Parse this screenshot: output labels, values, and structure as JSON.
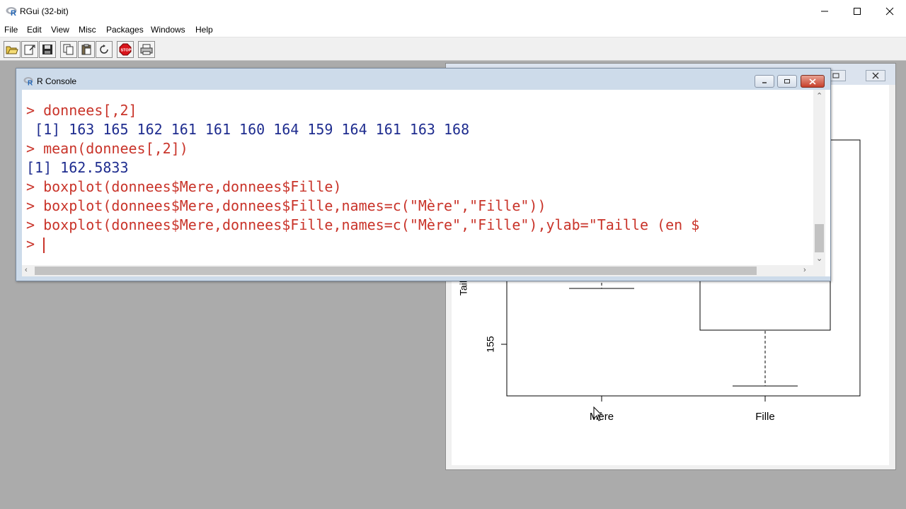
{
  "app": {
    "title": "RGui (32-bit)",
    "icon": "r-logo-icon"
  },
  "menu": {
    "items": [
      "File",
      "Edit",
      "View",
      "Misc",
      "Packages",
      "Windows",
      "Help"
    ]
  },
  "toolbar": {
    "buttons": [
      "open-script-icon",
      "load-workspace-icon",
      "save-workspace-icon",
      "copy-icon",
      "paste-icon",
      "copy-paste-icon",
      "stop-icon",
      "print-icon"
    ]
  },
  "console": {
    "title": "R Console",
    "lines": [
      {
        "type": "cmd",
        "text": "> donnees[,2]"
      },
      {
        "type": "out",
        "text": " [1] 163 165 162 161 161 160 164 159 164 161 163 168"
      },
      {
        "type": "cmd",
        "text": "> mean(donnees[,2])"
      },
      {
        "type": "out",
        "text": "[1] 162.5833"
      },
      {
        "type": "cmd",
        "text": "> boxplot(donnees$Mere,donnees$Fille)"
      },
      {
        "type": "cmd",
        "text": "> boxplot(donnees$Mere,donnees$Fille,names=c(\"Mère\",\"Fille\"))"
      },
      {
        "type": "cmd",
        "text": "> boxplot(donnees$Mere,donnees$Fille,names=c(\"Mère\",\"Fille\"),ylab=\"Taille (en $"
      }
    ],
    "prompt": "> "
  },
  "graphics": {
    "y_tick": "155",
    "y_label_partial": "Taill",
    "x_labels": [
      "Mère",
      "Fille"
    ]
  },
  "colors": {
    "command": "#c9342a",
    "output": "#1f2d8f",
    "mdi_background": "#ababab"
  }
}
